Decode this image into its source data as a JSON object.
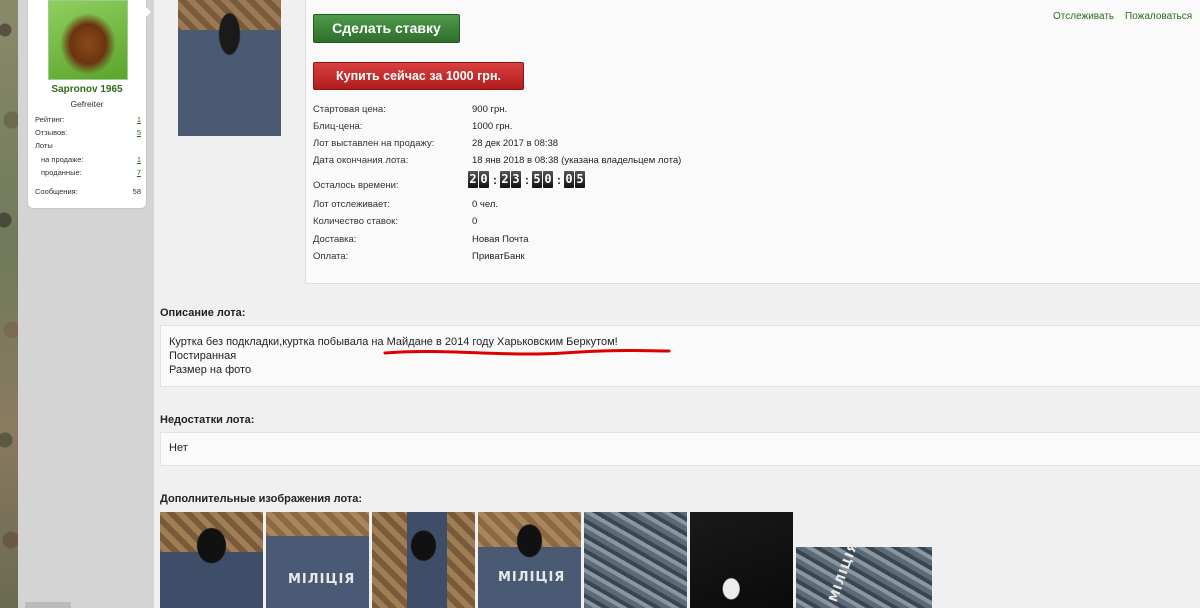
{
  "user": {
    "name": "Sapronov 1965",
    "rank": "Gefreiter",
    "stats": [
      {
        "label": "Рейтинг:",
        "value": "1"
      },
      {
        "label": "Отзывов:",
        "value": "5"
      },
      {
        "label": "Лоты",
        "value": ""
      },
      {
        "label": "на продаже:",
        "value": "1"
      },
      {
        "label": "проданные:",
        "value": "7"
      },
      {
        "label": "Сообщения:",
        "value": "58"
      }
    ]
  },
  "actions": {
    "bid": "Сделать ставку",
    "buy_now": "Купить сейчас за 1000 грн.",
    "watch": "Отслеживать",
    "report": "Пожаловаться"
  },
  "lot": {
    "rows": [
      {
        "label": "Стартовая цена:",
        "value": "900 грн."
      },
      {
        "label": "Блиц-цена:",
        "value": "1000 грн."
      },
      {
        "label": "Лот выставлен на продажу:",
        "value": "28 дек 2017 в 08:38"
      },
      {
        "label": "Дата окончания лота:",
        "value": "18 янв 2018 в 08:38 (указана владельцем лота)"
      },
      {
        "label": "Осталось времени:",
        "value": ""
      },
      {
        "label": "Лот отслеживает:",
        "value": "0 чел."
      },
      {
        "label": "Количество ставок:",
        "value": "0"
      },
      {
        "label": "Доставка:",
        "value": "Новая Почта"
      },
      {
        "label": "Оплата:",
        "value": "ПриватБанк"
      }
    ],
    "timer": [
      "2",
      "0",
      "2",
      "3",
      "5",
      "0",
      "0",
      "5"
    ]
  },
  "description": {
    "title": "Описание лота:",
    "lines": [
      "Куртка без подкладки,куртка побывала на Майдане в 2014 году Харьковским Беркутом!",
      "Постиранная",
      "Размер на фото"
    ]
  },
  "defects": {
    "title": "Недостатки лота:",
    "text": "Нет"
  },
  "images": {
    "title": "Дополнительные изображения лота:",
    "patch_text": "МІЛІЦІЯ"
  },
  "colors": {
    "green": "#2e6b1e",
    "red": "#b01c1c",
    "underline": "#dd0000"
  }
}
